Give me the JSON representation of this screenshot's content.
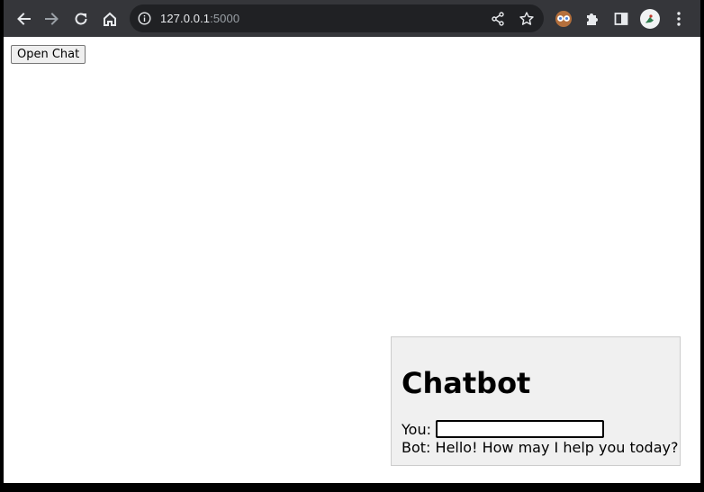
{
  "browser": {
    "url_host": "127.0.0.1",
    "url_port": ":5000",
    "toolbar_icons": [
      "back-arrow-icon",
      "forward-arrow-icon",
      "reload-icon",
      "home-icon",
      "info-icon",
      "share-icon",
      "star-icon",
      "extension-owl-icon",
      "puzzle-icon",
      "sidebar-icon",
      "profile-avatar",
      "kebab-menu-icon"
    ]
  },
  "page": {
    "open_chat_label": "Open Chat"
  },
  "chat": {
    "title": "Chatbot",
    "you_label": "You:",
    "input_value": "",
    "bot_label": "Bot:",
    "bot_message": "Hello! How may I help you today?"
  },
  "colors": {
    "toolbar": "#35363a",
    "omnibox": "#202124",
    "chat_bg": "#f0f0f0",
    "chat_border": "#cccccc"
  }
}
